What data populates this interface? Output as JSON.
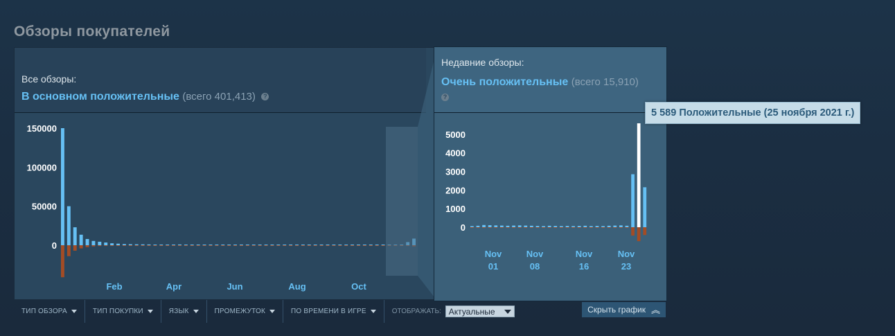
{
  "section_title": "Обзоры покупателей",
  "all_reviews": {
    "label": "Все обзоры:",
    "rating": "В основном положительные",
    "total": "(всего 401,413)",
    "help": "?"
  },
  "recent_reviews": {
    "label": "Недавние обзоры:",
    "rating": "Очень положительные",
    "total": "(всего 15,910)",
    "help": "?"
  },
  "tooltip": "5 589 Положительные (25 ноября 2021 г.)",
  "filters": [
    {
      "label": "ТИП ОБЗОРА"
    },
    {
      "label": "ТИП ПОКУПКИ"
    },
    {
      "label": "ЯЗЫК"
    },
    {
      "label": "ПРОМЕЖУТОК"
    },
    {
      "label": "ПО ВРЕМЕНИ В ИГРЕ"
    }
  ],
  "display_label": "ОТОБРАЖАТЬ:",
  "display_value": "Актуальные",
  "hide_graph_label": "Скрыть график",
  "colors": {
    "positive": "#66c0f4",
    "negative": "#a34c25",
    "highlight": "#ffffff",
    "rating": "#66c0f4"
  },
  "chart_data": [
    {
      "type": "bar",
      "title": "",
      "ytick_labels": [
        "150000",
        "100000",
        "50000",
        "0"
      ],
      "y_ticks": [
        150000,
        100000,
        50000,
        0
      ],
      "xtick_labels": [
        "Feb",
        "Apr",
        "Jun",
        "Aug",
        "Oct"
      ],
      "ylim": [
        -42000,
        150000
      ],
      "grid": false,
      "series": [
        {
          "name": "",
          "values": [
            150000,
            50000,
            23000,
            13500,
            8000,
            5500,
            4500,
            3500,
            2500,
            2000,
            1500,
            1300,
            1200,
            1100,
            1000,
            900,
            900,
            800,
            800,
            1000,
            800,
            700,
            700,
            700,
            650,
            650,
            600,
            600,
            600,
            550,
            550,
            550,
            500,
            500,
            500,
            500,
            500,
            500,
            500,
            500,
            500,
            500,
            500,
            500,
            500,
            500,
            500,
            500,
            500,
            500,
            500,
            500,
            500,
            500,
            500,
            500,
            4000,
            8500
          ]
        },
        {
          "name": "",
          "values": [
            -41000,
            -14000,
            -7000,
            -4000,
            -2500,
            -1500,
            -1000,
            -800,
            -600,
            -500,
            -400,
            -300,
            -300,
            -300,
            -250,
            -200,
            -200,
            -200,
            -200,
            -200,
            -200,
            -150,
            -150,
            -150,
            -150,
            -150,
            -150,
            -150,
            -150,
            -150,
            -150,
            -150,
            -150,
            -150,
            -150,
            -150,
            -150,
            -150,
            -150,
            -150,
            -150,
            -150,
            -150,
            -150,
            -150,
            -150,
            -150,
            -150,
            -150,
            -150,
            -150,
            -150,
            -150,
            -150,
            -150,
            -150,
            -700,
            -1500
          ]
        }
      ]
    },
    {
      "type": "bar",
      "title": "",
      "ytick_labels": [
        "5000",
        "4000",
        "3000",
        "2000",
        "1000",
        "0"
      ],
      "y_ticks": [
        5000,
        4000,
        3000,
        2000,
        1000,
        0
      ],
      "xtick_labels": [
        "Nov\n01",
        "Nov\n08",
        "Nov\n16",
        "Nov\n23"
      ],
      "ylim": [
        -800,
        5589
      ],
      "grid": false,
      "series": [
        {
          "name": "",
          "values": [
            60,
            80,
            120,
            110,
            100,
            90,
            80,
            90,
            100,
            90,
            80,
            70,
            60,
            80,
            70,
            60,
            70,
            60,
            70,
            80,
            60,
            70,
            60,
            80,
            90,
            100,
            80,
            2850,
            5589,
            2150
          ]
        },
        {
          "name": "",
          "values": [
            -10,
            -10,
            -15,
            -15,
            -10,
            -10,
            -10,
            -10,
            -10,
            -10,
            -10,
            -10,
            -10,
            -10,
            -10,
            -10,
            -10,
            -10,
            -10,
            -10,
            -10,
            -10,
            -10,
            -10,
            -10,
            -10,
            -10,
            -450,
            -750,
            -420
          ]
        }
      ]
    }
  ]
}
